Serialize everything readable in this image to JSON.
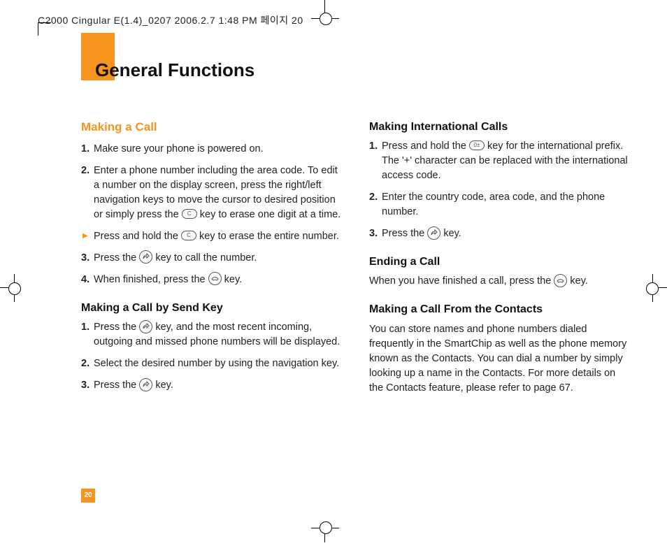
{
  "header_slug": "C2000 Cingular E(1.4)_0207  2006.2.7 1:48 PM  페이지 20",
  "page_title": "General Functions",
  "page_number": "20",
  "left": {
    "h1": "Making a Call",
    "i1_num": "1.",
    "i1": "Make sure your phone is powered on.",
    "i2_num": "2.",
    "i2a": "Enter a phone number including the area code. To edit a number on the display screen, press the right/left navigation keys to move the cursor to desired position or simply press the ",
    "i2b": " key to erase one digit at a time.",
    "bullet_a": "Press and hold the ",
    "bullet_b": " key to erase the entire number.",
    "i3_num": "3.",
    "i3a": "Press the ",
    "i3b": " key to call the number.",
    "i4_num": "4.",
    "i4a": "When finished, press the ",
    "i4b": " key.",
    "h2": "Making a Call by Send Key",
    "s1_num": "1.",
    "s1a": "Press the ",
    "s1b": " key, and the most recent incoming, outgoing and missed phone numbers will be displayed.",
    "s2_num": "2.",
    "s2": "Select the desired number by using the navigation key.",
    "s3_num": "3.",
    "s3a": "Press the ",
    "s3b": " key."
  },
  "right": {
    "h1": "Making International Calls",
    "i1_num": "1.",
    "i1a": "Press and hold the ",
    "i1b": " key for the international prefix. The '+' character can be replaced with the international access code.",
    "i2_num": "2.",
    "i2": "Enter the country code, area code, and the phone number.",
    "i3_num": "3.",
    "i3a": "Press the ",
    "i3b": " key.",
    "h2": "Ending a Call",
    "p1a": "When you have finished a call, press the ",
    "p1b": " key.",
    "h3": "Making a Call From the Contacts",
    "p2": "You can store names and phone numbers dialed frequently in the SmartChip as well as the phone memory known as the Contacts. You can dial a number by simply looking up a name in the Contacts. For more details on the Contacts feature, please refer to page 67."
  },
  "keys": {
    "clear": "C",
    "zero": "0±"
  }
}
